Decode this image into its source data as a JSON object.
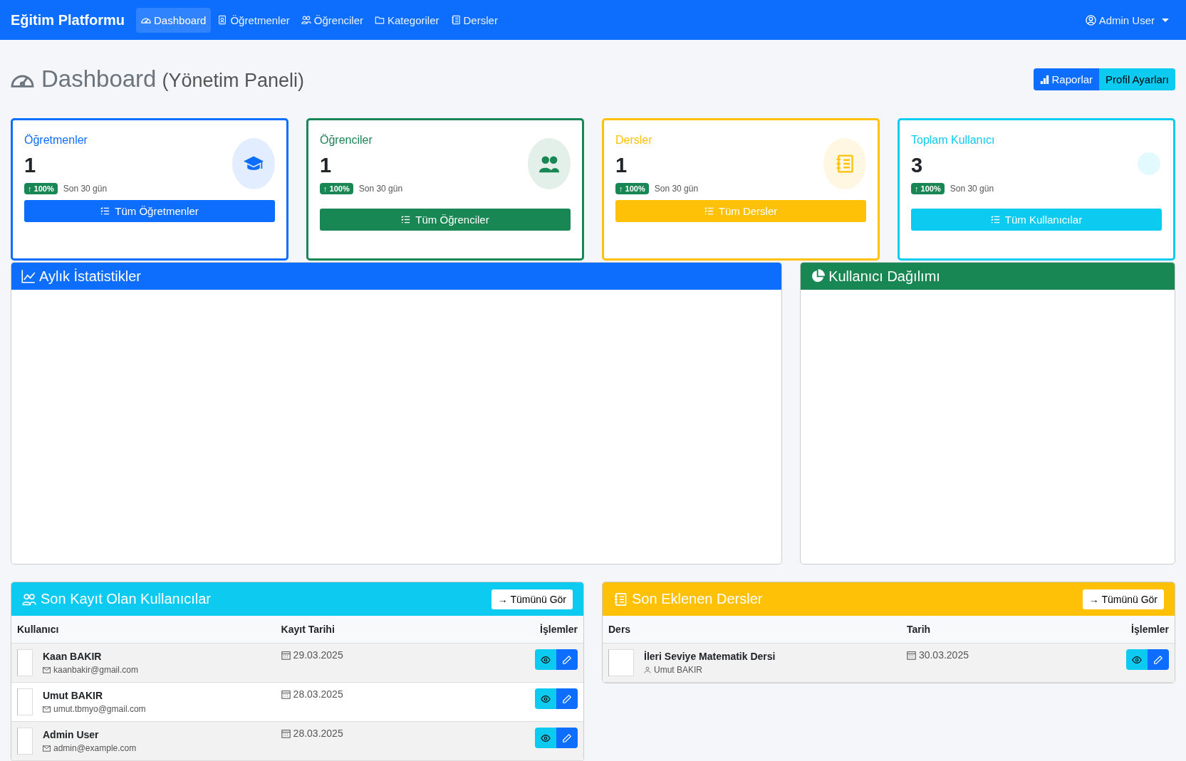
{
  "navbar": {
    "brand": "Eğitim Platformu",
    "items": [
      {
        "label": "Dashboard",
        "kind": "gauge",
        "selected": true
      },
      {
        "label": "Öğretmenler",
        "kind": "badge",
        "selected": false
      },
      {
        "label": "Öğrenciler",
        "kind": "people",
        "selected": false
      },
      {
        "label": "Kategoriler",
        "kind": "folder",
        "selected": false
      },
      {
        "label": "Dersler",
        "kind": "notebook",
        "selected": false
      }
    ],
    "user": "Admin User"
  },
  "header": {
    "title": "Dashboard",
    "subtitle": "(Yönetim Paneli)",
    "buttons": [
      {
        "label": "Raporlar",
        "color": "#0d6efd"
      },
      {
        "label": "Profil Ayarları",
        "color": "#0dcaf0"
      }
    ]
  },
  "stats": [
    {
      "title": "Öğretmenler",
      "value": "1",
      "change": "↑ 100%",
      "period": "Son 30 gün",
      "button": "Tüm Öğretmenler",
      "color": "#0d6efd",
      "kind": "cap"
    },
    {
      "title": "Öğrenciler",
      "value": "1",
      "change": "↑ 100%",
      "period": "Son 30 gün",
      "button": "Tüm Öğrenciler",
      "color": "#198754",
      "kind": "people"
    },
    {
      "title": "Dersler",
      "value": "1",
      "change": "↑ 100%",
      "period": "Son 30 gün",
      "button": "Tüm Dersler",
      "color": "#ffc107",
      "kind": "notebook"
    },
    {
      "title": "Toplam Kullanıcı",
      "value": "3",
      "change": "↑ 100%",
      "period": "Son 30 gün",
      "button": "Tüm Kullanıcılar",
      "color": "#0dcaf0",
      "kind": "none"
    }
  ],
  "charts": [
    {
      "title": "Aylık İstatistikler",
      "color": "#0d6efd",
      "kind": "line"
    },
    {
      "title": "Kullanıcı Dağılımı",
      "color": "#198754",
      "kind": "pie"
    }
  ],
  "tables": [
    {
      "title": "Son Kayıt Olan Kullanıcılar",
      "color": "#0dcaf0",
      "kind": "people",
      "link": "→ Tümünü Gör",
      "columns": [
        "Kullanıcı",
        "Kayıt Tarihi",
        "İşlemler"
      ],
      "rows": [
        {
          "name": "Kaan BAKIR",
          "detail": "kaanbakir@gmail.com",
          "date": "29.03.2025"
        },
        {
          "name": "Umut BAKIR",
          "detail": "umut.tbmyo@gmail.com",
          "date": "28.03.2025"
        },
        {
          "name": "Admin User",
          "detail": "admin@example.com",
          "date": "28.03.2025"
        }
      ]
    },
    {
      "title": "Son Eklenen Dersler",
      "color": "#ffc107",
      "kind": "notebook",
      "link": "→ Tümünü Gör",
      "columns": [
        "Ders",
        "Tarih",
        "İşlemler"
      ],
      "rows": [
        {
          "name": "İleri Seviye Matematik Dersi",
          "detail": "Umut BAKIR",
          "date": "30.03.2025"
        }
      ]
    }
  ]
}
